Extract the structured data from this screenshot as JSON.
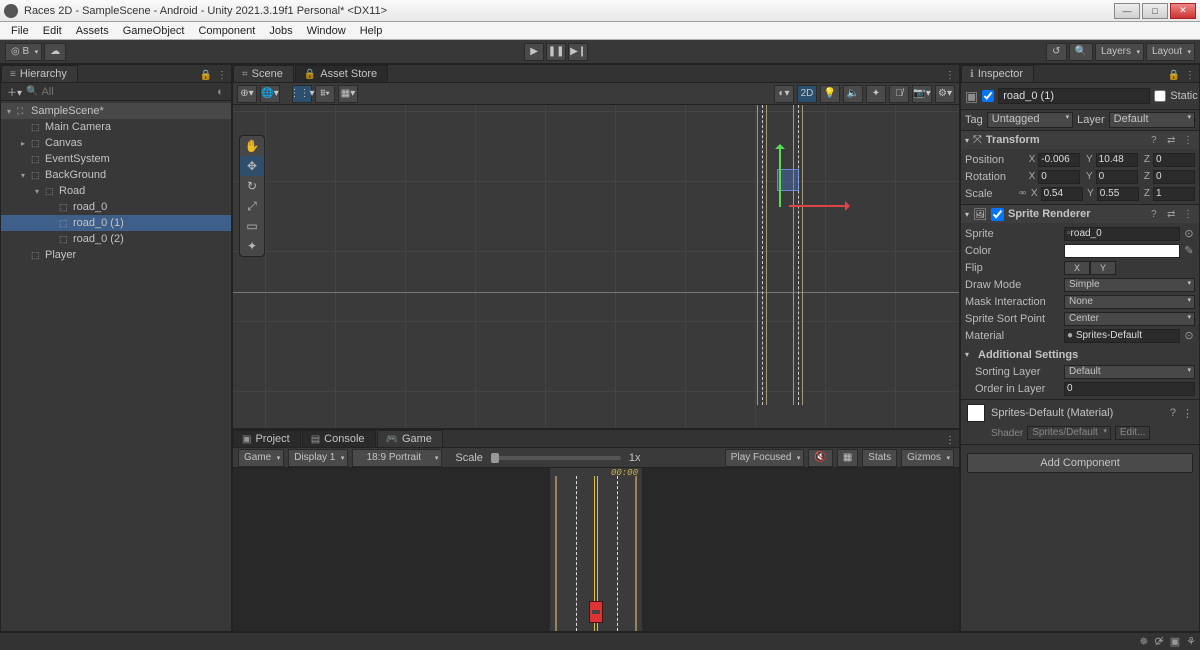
{
  "window": {
    "title": "Races 2D - SampleScene - Android - Unity 2021.3.19f1 Personal* <DX11>"
  },
  "menu": [
    "File",
    "Edit",
    "Assets",
    "GameObject",
    "Component",
    "Jobs",
    "Window",
    "Help"
  ],
  "topbar": {
    "layers": "Layers",
    "layout": "Layout"
  },
  "hierarchy": {
    "tab": "Hierarchy",
    "searchPlaceholder": "All",
    "items": [
      {
        "label": "SampleScene*",
        "indent": 0,
        "scene": true,
        "fold": "▾"
      },
      {
        "label": "Main Camera",
        "indent": 1
      },
      {
        "label": "Canvas",
        "indent": 1,
        "fold": "▸"
      },
      {
        "label": "EventSystem",
        "indent": 1
      },
      {
        "label": "BackGround",
        "indent": 1,
        "fold": "▾"
      },
      {
        "label": "Road",
        "indent": 2,
        "fold": "▾"
      },
      {
        "label": "road_0",
        "indent": 3
      },
      {
        "label": "road_0 (1)",
        "indent": 3,
        "sel": true
      },
      {
        "label": "road_0 (2)",
        "indent": 3
      },
      {
        "label": "Player",
        "indent": 1
      }
    ]
  },
  "scene": {
    "tabs": [
      "Scene",
      "Asset Store"
    ],
    "mode2d": "2D"
  },
  "bottom": {
    "tabs": [
      "Project",
      "Console",
      "Game"
    ],
    "gameDrop": "Game",
    "display": "Display 1",
    "aspect": "18:9 Portrait",
    "scaleLabel": "Scale",
    "scaleVal": "1x",
    "playFocused": "Play Focused",
    "stats": "Stats",
    "gizmos": "Gizmos",
    "hudTime": "00:00"
  },
  "inspector": {
    "tab": "Inspector",
    "name": "road_0 (1)",
    "static": "Static",
    "tagLabel": "Tag",
    "tag": "Untagged",
    "layerLabel": "Layer",
    "layer": "Default",
    "transform": {
      "title": "Transform",
      "position": {
        "label": "Position",
        "x": "-0.006",
        "y": "10.48",
        "z": "0"
      },
      "rotation": {
        "label": "Rotation",
        "x": "0",
        "y": "0",
        "z": "0"
      },
      "scale": {
        "label": "Scale",
        "x": "0.54",
        "y": "0.55",
        "z": "1"
      }
    },
    "spriteRenderer": {
      "title": "Sprite Renderer",
      "sprite": {
        "label": "Sprite",
        "value": "road_0"
      },
      "color": {
        "label": "Color"
      },
      "flip": {
        "label": "Flip",
        "x": "X",
        "y": "Y"
      },
      "drawMode": {
        "label": "Draw Mode",
        "value": "Simple"
      },
      "maskInteraction": {
        "label": "Mask Interaction",
        "value": "None"
      },
      "sortPoint": {
        "label": "Sprite Sort Point",
        "value": "Center"
      },
      "material": {
        "label": "Material",
        "value": "Sprites-Default"
      },
      "additional": {
        "title": "Additional Settings",
        "sortingLayer": {
          "label": "Sorting Layer",
          "value": "Default"
        },
        "orderInLayer": {
          "label": "Order in Layer",
          "value": "0"
        }
      }
    },
    "materialBox": {
      "name": "Sprites-Default (Material)",
      "shaderLabel": "Shader",
      "shader": "Sprites/Default",
      "edit": "Edit..."
    },
    "addComponent": "Add Component"
  }
}
